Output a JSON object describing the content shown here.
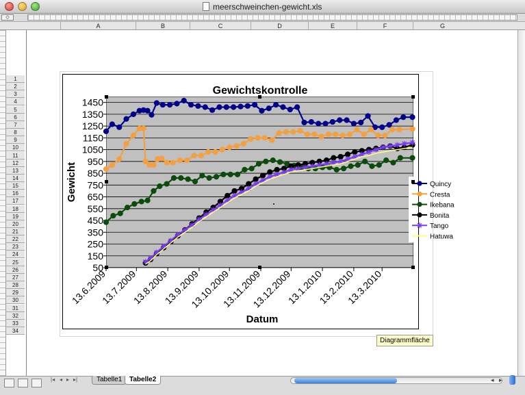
{
  "window": {
    "title": "meerschweinchen-gewicht.xls"
  },
  "toolbar": {
    "select_all": "◇"
  },
  "columns": [
    "A",
    "B",
    "C",
    "D",
    "E",
    "F",
    "G"
  ],
  "rows": [
    "1",
    "2",
    "3",
    "4",
    "5",
    "6",
    "7",
    "8",
    "9",
    "10",
    "11",
    "12",
    "13",
    "14",
    "15",
    "16",
    "17",
    "18",
    "19",
    "20",
    "21",
    "22",
    "23",
    "24",
    "25",
    "26",
    "27",
    "28",
    "29",
    "30",
    "31",
    "32",
    "33",
    "34"
  ],
  "sheet_tabs": [
    {
      "label": "Tabelle1",
      "active": false
    },
    {
      "label": "Tabelle2",
      "active": true
    }
  ],
  "tooltip": "Diagrammfläche",
  "chart_data": {
    "type": "line",
    "title": "Gewichtskontrolle",
    "xlabel": "Datum",
    "ylabel": "Gewicht",
    "x_tick_labels": [
      "13.6.2009",
      "13.7.2009",
      "13.8.2009",
      "13.9.2009",
      "13.10.2009",
      "13.11.2009",
      "13.12.2009",
      "13.1.2010",
      "13.2.2010",
      "13.3.2010"
    ],
    "xlim": [
      "2009-06-13",
      "2010-04-13"
    ],
    "yticks": [
      50,
      150,
      250,
      350,
      450,
      550,
      650,
      750,
      850,
      950,
      1050,
      1150,
      1250,
      1350,
      1450
    ],
    "ylim": [
      50,
      1500
    ],
    "grid": "horizontal",
    "legend_position": "right",
    "series": [
      {
        "name": "Quincy",
        "color": "#00008b",
        "marker": "circle",
        "x": [
          "2009-06-13",
          "2009-06-19",
          "2009-06-26",
          "2009-07-03",
          "2009-07-10",
          "2009-07-16",
          "2009-07-20",
          "2009-07-24",
          "2009-07-28",
          "2009-08-02",
          "2009-08-08",
          "2009-08-15",
          "2009-08-22",
          "2009-08-29",
          "2009-09-05",
          "2009-09-12",
          "2009-09-19",
          "2009-09-26",
          "2009-10-03",
          "2009-10-10",
          "2009-10-17",
          "2009-10-24",
          "2009-10-31",
          "2009-11-07",
          "2009-11-14",
          "2009-11-21",
          "2009-11-28",
          "2009-12-05",
          "2009-12-12",
          "2009-12-19",
          "2009-12-26",
          "2010-01-02",
          "2010-01-09",
          "2010-01-16",
          "2010-01-23",
          "2010-01-30",
          "2010-02-06",
          "2010-02-13",
          "2010-02-20",
          "2010-02-27",
          "2010-03-06",
          "2010-03-13",
          "2010-03-20",
          "2010-03-27",
          "2010-04-03",
          "2010-04-12"
        ],
        "y": [
          1205,
          1265,
          1240,
          1310,
          1350,
          1380,
          1385,
          1380,
          1345,
          1445,
          1430,
          1430,
          1440,
          1465,
          1430,
          1420,
          1410,
          1385,
          1410,
          1410,
          1410,
          1415,
          1420,
          1430,
          1380,
          1400,
          1430,
          1410,
          1390,
          1410,
          1280,
          1285,
          1270,
          1270,
          1285,
          1300,
          1300,
          1270,
          1280,
          1335,
          1240,
          1240,
          1260,
          1300,
          1325,
          1325
        ]
      },
      {
        "name": "Cresta",
        "color": "#f5a040",
        "marker": "circle",
        "x": [
          "2009-06-13",
          "2009-06-19",
          "2009-06-26",
          "2009-07-03",
          "2009-07-10",
          "2009-07-16",
          "2009-07-20",
          "2009-07-22",
          "2009-07-26",
          "2009-07-30",
          "2009-08-03",
          "2009-08-07",
          "2009-08-12",
          "2009-08-18",
          "2009-08-25",
          "2009-09-01",
          "2009-09-08",
          "2009-09-15",
          "2009-09-22",
          "2009-09-29",
          "2009-10-06",
          "2009-10-13",
          "2009-10-20",
          "2009-10-27",
          "2009-11-03",
          "2009-11-10",
          "2009-11-17",
          "2009-11-24",
          "2009-12-01",
          "2009-12-08",
          "2009-12-15",
          "2009-12-22",
          "2009-12-29",
          "2010-01-05",
          "2010-01-12",
          "2010-01-19",
          "2010-01-26",
          "2010-02-02",
          "2010-02-09",
          "2010-02-16",
          "2010-02-23",
          "2010-03-02",
          "2010-03-09",
          "2010-03-16",
          "2010-03-23",
          "2010-03-30",
          "2010-04-12"
        ],
        "y": [
          885,
          920,
          970,
          1100,
          1170,
          1230,
          1230,
          950,
          920,
          920,
          970,
          975,
          940,
          940,
          960,
          960,
          1000,
          1000,
          1030,
          1030,
          1050,
          1070,
          1080,
          1100,
          1140,
          1150,
          1150,
          1130,
          1190,
          1200,
          1200,
          1210,
          1180,
          1180,
          1160,
          1180,
          1180,
          1170,
          1180,
          1220,
          1180,
          1220,
          1170,
          1170,
          1220,
          1220,
          1225
        ]
      },
      {
        "name": "Ikebana",
        "color": "#0c4b0c",
        "marker": "circle",
        "x": [
          "2009-06-13",
          "2009-06-20",
          "2009-06-27",
          "2009-07-04",
          "2009-07-11",
          "2009-07-18",
          "2009-07-24",
          "2009-07-30",
          "2009-08-05",
          "2009-08-12",
          "2009-08-19",
          "2009-08-26",
          "2009-09-02",
          "2009-09-09",
          "2009-09-16",
          "2009-09-23",
          "2009-09-30",
          "2009-10-07",
          "2009-10-14",
          "2009-10-21",
          "2009-10-28",
          "2009-11-04",
          "2009-11-11",
          "2009-11-18",
          "2009-11-25",
          "2009-12-02",
          "2009-12-09",
          "2009-12-16",
          "2009-12-23",
          "2009-12-30",
          "2010-01-06",
          "2010-01-13",
          "2010-01-20",
          "2010-01-27",
          "2010-02-03",
          "2010-02-10",
          "2010-02-17",
          "2010-02-24",
          "2010-03-03",
          "2010-03-10",
          "2010-03-17",
          "2010-03-24",
          "2010-03-31",
          "2010-04-12"
        ],
        "y": [
          435,
          490,
          510,
          560,
          590,
          610,
          620,
          700,
          740,
          760,
          810,
          810,
          800,
          780,
          830,
          810,
          820,
          840,
          840,
          840,
          880,
          890,
          930,
          950,
          960,
          945,
          930,
          915,
          900,
          890,
          890,
          900,
          900,
          880,
          890,
          910,
          920,
          950,
          910,
          920,
          960,
          940,
          980,
          980
        ]
      },
      {
        "name": "Bonita",
        "color": "#000000",
        "marker": "circle",
        "x": [
          "2009-07-22",
          "2009-07-27",
          "2009-08-02",
          "2009-08-09",
          "2009-08-16",
          "2009-08-23",
          "2009-08-30",
          "2009-09-06",
          "2009-09-13",
          "2009-09-20",
          "2009-09-27",
          "2009-10-04",
          "2009-10-11",
          "2009-10-18",
          "2009-10-25",
          "2009-11-01",
          "2009-11-08",
          "2009-11-15",
          "2009-11-22",
          "2009-11-29",
          "2009-12-06",
          "2009-12-13",
          "2009-12-20",
          "2009-12-27",
          "2010-01-03",
          "2010-01-10",
          "2010-01-17",
          "2010-01-24",
          "2010-01-31",
          "2010-02-07",
          "2010-02-14",
          "2010-02-21",
          "2010-02-28",
          "2010-03-07",
          "2010-03-14",
          "2010-03-21",
          "2010-03-28",
          "2010-04-04",
          "2010-04-12"
        ],
        "y": [
          90,
          120,
          170,
          220,
          270,
          320,
          370,
          420,
          470,
          520,
          560,
          610,
          660,
          700,
          720,
          760,
          800,
          830,
          860,
          880,
          890,
          910,
          920,
          930,
          940,
          950,
          960,
          980,
          990,
          1010,
          1030,
          1040,
          1050,
          1060,
          1070,
          1080,
          1060,
          1070,
          1090
        ]
      },
      {
        "name": "Tango",
        "color": "#7b3cf0",
        "marker": "star",
        "x": [
          "2009-07-22",
          "2009-07-27",
          "2009-08-02",
          "2009-08-09",
          "2009-08-16",
          "2009-08-23",
          "2009-08-30",
          "2009-09-06",
          "2009-09-13",
          "2009-09-20",
          "2009-09-27",
          "2009-10-04",
          "2009-10-11",
          "2009-10-18",
          "2009-10-25",
          "2009-11-01",
          "2009-11-08",
          "2009-11-15",
          "2009-11-22",
          "2009-11-29",
          "2009-12-06",
          "2009-12-13",
          "2009-12-20",
          "2009-12-27",
          "2010-01-03",
          "2010-01-10",
          "2010-01-17",
          "2010-01-24",
          "2010-01-31",
          "2010-02-07",
          "2010-02-14",
          "2010-02-21",
          "2010-02-28",
          "2010-03-07",
          "2010-03-14",
          "2010-03-21",
          "2010-03-28",
          "2010-04-04",
          "2010-04-12"
        ],
        "y": [
          100,
          130,
          180,
          230,
          280,
          330,
          370,
          410,
          460,
          500,
          540,
          580,
          620,
          660,
          690,
          720,
          760,
          790,
          820,
          840,
          860,
          880,
          890,
          900,
          910,
          920,
          930,
          940,
          950,
          970,
          990,
          1010,
          1030,
          1050,
          1070,
          1080,
          1090,
          1100,
          1110
        ]
      },
      {
        "name": "Hatuwa",
        "color": "#ffff80",
        "marker": "none",
        "x": [
          "2009-07-22",
          "2009-07-27",
          "2009-08-02",
          "2009-08-09",
          "2009-08-16",
          "2009-08-23",
          "2009-08-30",
          "2009-09-06",
          "2009-09-13",
          "2009-09-20",
          "2009-09-27",
          "2009-10-04",
          "2009-10-11",
          "2009-10-18",
          "2009-10-25",
          "2009-11-01",
          "2009-11-08",
          "2009-11-15",
          "2009-11-22",
          "2009-11-29",
          "2009-12-06",
          "2009-12-13",
          "2009-12-20",
          "2009-12-27",
          "2010-01-03",
          "2010-01-10",
          "2010-01-17",
          "2010-01-24",
          "2010-01-31",
          "2010-02-07",
          "2010-02-14",
          "2010-02-21",
          "2010-02-28",
          "2010-03-07",
          "2010-03-14",
          "2010-03-21",
          "2010-03-28",
          "2010-04-04",
          "2010-04-12"
        ],
        "y": [
          80,
          110,
          160,
          210,
          260,
          310,
          350,
          390,
          440,
          480,
          520,
          560,
          600,
          640,
          670,
          700,
          740,
          770,
          800,
          820,
          840,
          860,
          870,
          880,
          890,
          900,
          910,
          920,
          930,
          950,
          970,
          990,
          1000,
          1020,
          1030,
          1040,
          1050,
          1060,
          1070
        ]
      }
    ]
  }
}
